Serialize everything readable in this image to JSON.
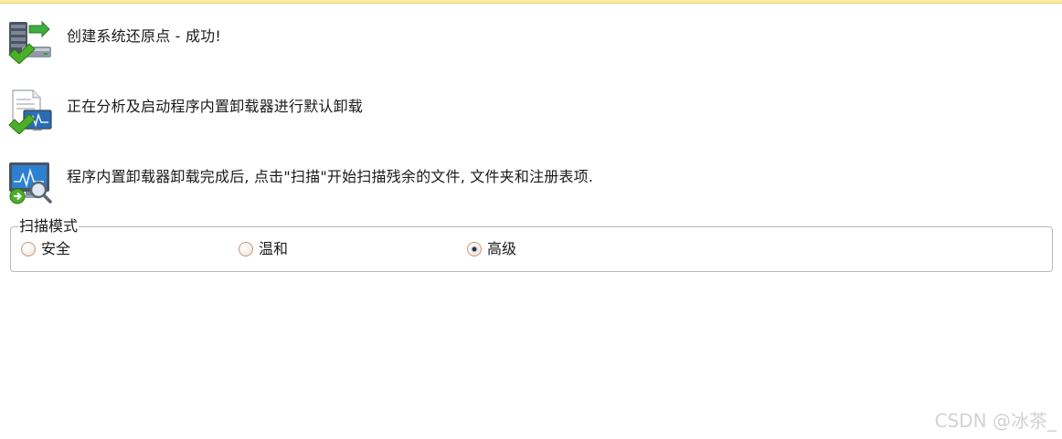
{
  "steps": [
    {
      "icon": "server-restore-check-icon",
      "text": "创建系统还原点 - 成功!"
    },
    {
      "icon": "document-monitor-check-icon",
      "text": "正在分析及启动程序内置卸载器进行默认卸载"
    },
    {
      "icon": "monitor-scan-icon",
      "text": "程序内置卸载器卸载完成后, 点击\"扫描\"开始扫描残余的文件, 文件夹和注册表项."
    }
  ],
  "scan_mode": {
    "title": "扫描模式",
    "options": [
      {
        "label": "安全",
        "selected": false
      },
      {
        "label": "温和",
        "selected": false
      },
      {
        "label": "高级",
        "selected": true
      }
    ]
  },
  "watermark": "CSDN @冰茶_",
  "colors": {
    "top_line": "#fbe9a6",
    "check_green": "#4caf2a",
    "radio_border": "#c79b7a",
    "group_border": "#b9b9b9",
    "watermark": "#d2d2d2"
  }
}
